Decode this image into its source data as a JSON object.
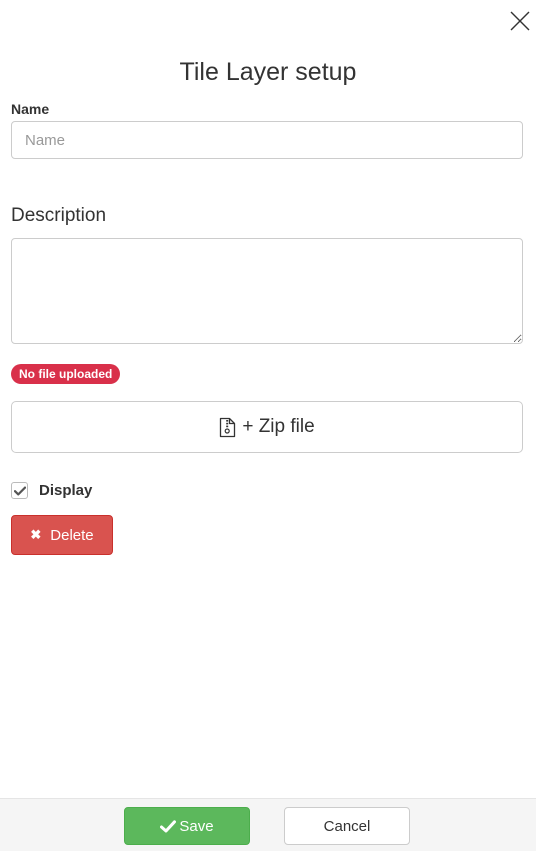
{
  "dialog": {
    "title": "Tile Layer setup",
    "close_icon": "close-icon"
  },
  "form": {
    "name_label": "Name",
    "name_placeholder": "Name",
    "name_value": "",
    "description_label": "Description",
    "description_value": "",
    "file_status": "No file uploaded",
    "zip_button_label": "+ Zip file",
    "zip_icon": "file-zip-icon",
    "display_label": "Display",
    "display_checked": true,
    "delete_label": "Delete",
    "delete_icon": "times-icon"
  },
  "footer": {
    "save_label": "Save",
    "save_icon": "check-icon",
    "cancel_label": "Cancel"
  },
  "colors": {
    "danger": "#d9534f",
    "badge": "#d9304a",
    "success": "#5cb85c",
    "footer_bg": "#f5f5f5"
  }
}
